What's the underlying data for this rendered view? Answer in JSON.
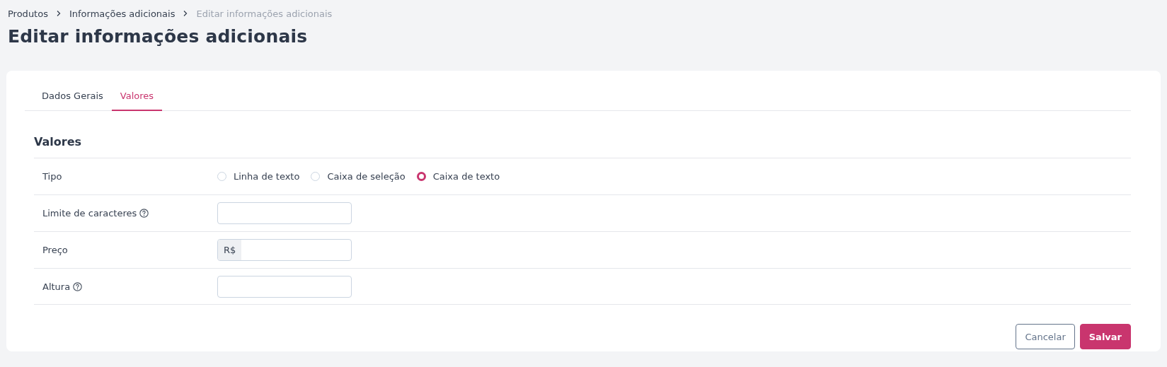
{
  "breadcrumb": [
    {
      "label": "Produtos",
      "current": false
    },
    {
      "label": "Informações adicionais",
      "current": false
    },
    {
      "label": "Editar informações adicionais",
      "current": true
    }
  ],
  "title": "Editar informações adicionais",
  "tabs": [
    {
      "label": "Dados Gerais",
      "selected": false
    },
    {
      "label": "Valores",
      "selected": true
    }
  ],
  "section": {
    "title": "Valores",
    "rows": [
      {
        "kind": "radio",
        "label": "Tipo",
        "help": false,
        "options": [
          {
            "label": "Linha de texto",
            "selected": false
          },
          {
            "label": "Caixa de seleção",
            "selected": false
          },
          {
            "label": "Caixa de texto",
            "selected": true
          }
        ]
      },
      {
        "kind": "input",
        "label": "Limite de caracteres",
        "help": true
      },
      {
        "kind": "currency",
        "label": "Preço",
        "help": false,
        "prefix": "R$"
      },
      {
        "kind": "input",
        "label": "Altura",
        "help": true
      }
    ]
  },
  "buttons": [
    {
      "label": "Cancelar",
      "kind": "secondary"
    },
    {
      "label": "Salvar",
      "kind": "primary"
    }
  ]
}
